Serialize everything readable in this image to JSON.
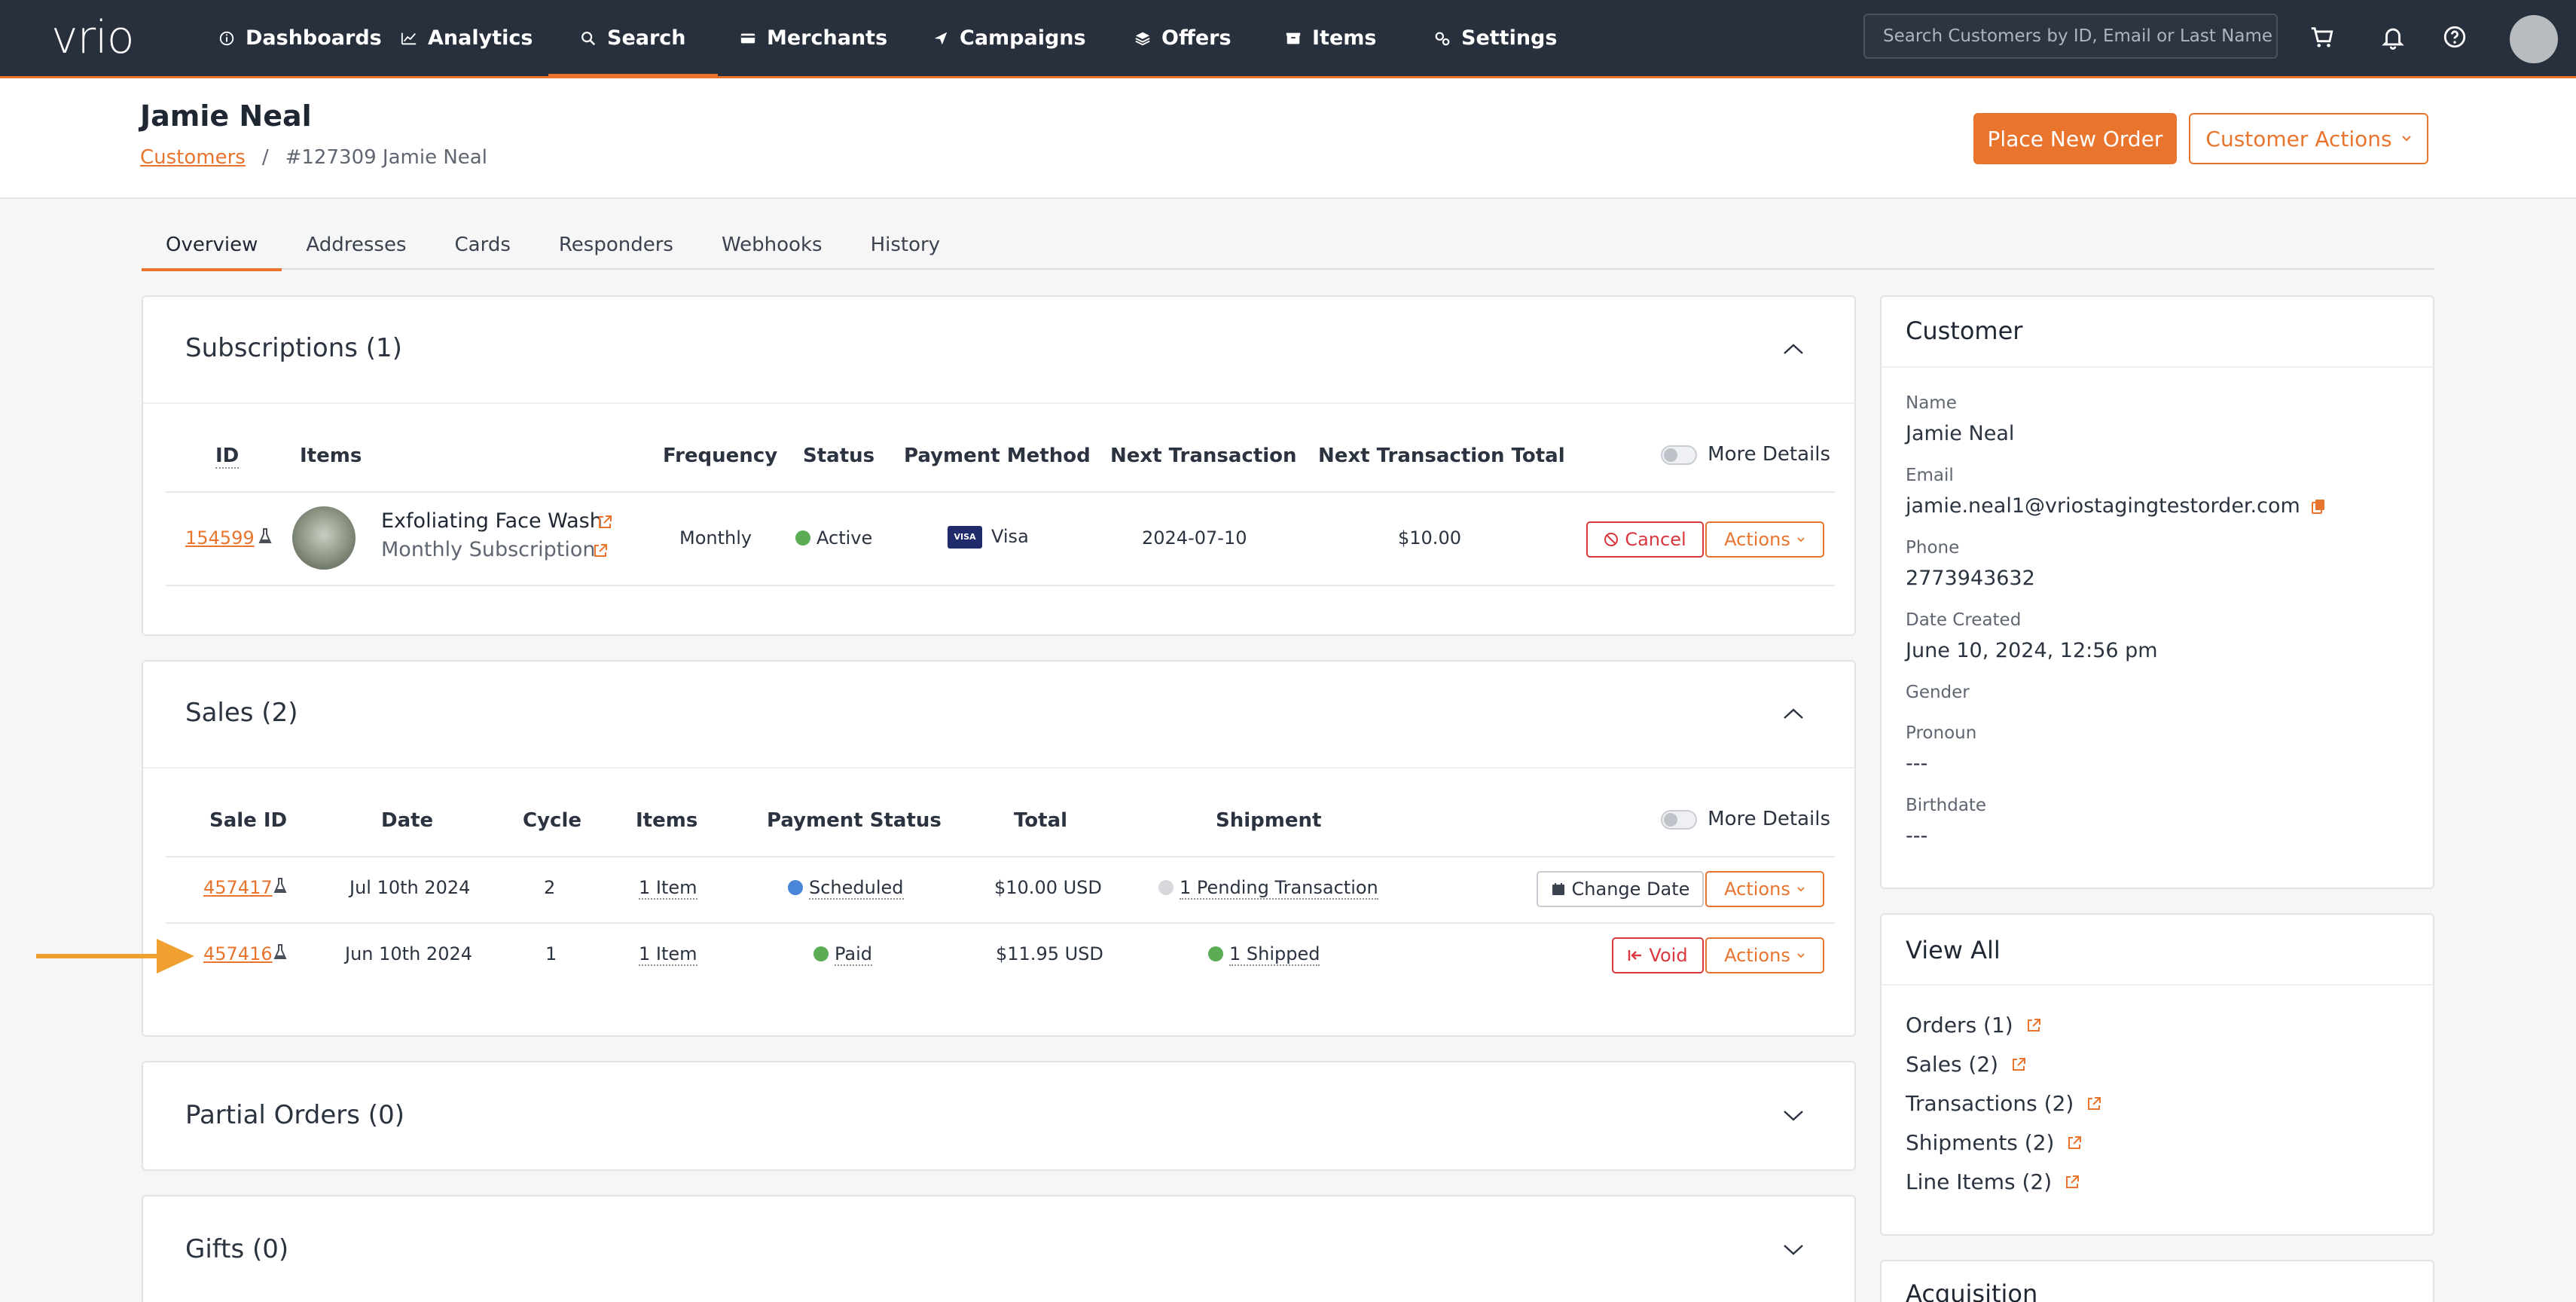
{
  "nav": {
    "logo": "vrio",
    "items": [
      {
        "label": "Dashboards",
        "icon": "info-circle-icon"
      },
      {
        "label": "Analytics",
        "icon": "line-chart-icon"
      },
      {
        "label": "Search",
        "icon": "search-icon"
      },
      {
        "label": "Merchants",
        "icon": "credit-card-icon"
      },
      {
        "label": "Campaigns",
        "icon": "paper-plane-icon"
      },
      {
        "label": "Offers",
        "icon": "layers-icon"
      },
      {
        "label": "Items",
        "icon": "box-icon"
      },
      {
        "label": "Settings",
        "icon": "gears-icon"
      }
    ],
    "active": "Search",
    "search_placeholder": "Search Customers by ID, Email or Last Name"
  },
  "header": {
    "title": "Jamie Neal",
    "breadcrumb_root": "Customers",
    "breadcrumb_sep": "/",
    "breadcrumb_current": "#127309 Jamie Neal",
    "place_order_label": "Place New Order",
    "customer_actions_label": "Customer Actions"
  },
  "tabs": [
    "Overview",
    "Addresses",
    "Cards",
    "Responders",
    "Webhooks",
    "History"
  ],
  "active_tab": "Overview",
  "subscriptions": {
    "title": "Subscriptions (1)",
    "more_details": "More Details",
    "columns": [
      "ID",
      "Items",
      "Frequency",
      "Status",
      "Payment Method",
      "Next Transaction",
      "Next Transaction Total"
    ],
    "rows": [
      {
        "id": "154599",
        "item_name": "Exfoliating Face Wash",
        "item_sub": "Monthly Subscription",
        "frequency": "Monthly",
        "status": "Active",
        "payment_method": "Visa",
        "card_badge": "VISA",
        "next_transaction": "2024-07-10",
        "next_total": "$10.00",
        "cancel_label": "Cancel",
        "actions_label": "Actions"
      }
    ]
  },
  "sales": {
    "title": "Sales (2)",
    "more_details": "More Details",
    "columns": [
      "Sale ID",
      "Date",
      "Cycle",
      "Items",
      "Payment Status",
      "Total",
      "Shipment"
    ],
    "rows": [
      {
        "id": "457417",
        "date": "Jul 10th 2024",
        "cycle": "2",
        "items": "1 Item",
        "payment_status": "Scheduled",
        "payment_color": "#4a86d8",
        "total": "$10.00 USD",
        "shipment": "1 Pending Transaction",
        "shipment_color": "#d6d8dc",
        "action1": "Change Date",
        "actions_label": "Actions"
      },
      {
        "id": "457416",
        "date": "Jun 10th 2024",
        "cycle": "1",
        "items": "1 Item",
        "payment_status": "Paid",
        "payment_color": "#5aac55",
        "total": "$11.95 USD",
        "shipment": "1 Shipped",
        "shipment_color": "#5aac55",
        "action1": "Void",
        "actions_label": "Actions"
      }
    ]
  },
  "partial_orders": {
    "title": "Partial Orders (0)"
  },
  "gifts": {
    "title": "Gifts (0)"
  },
  "customer": {
    "title": "Customer",
    "fields": [
      {
        "label": "Name",
        "value": "Jamie Neal"
      },
      {
        "label": "Email",
        "value": "jamie.neal1@vriostagingtestorder.com"
      },
      {
        "label": "Phone",
        "value": "2773943632"
      },
      {
        "label": "Date Created",
        "value": "June 10, 2024, 12:56 pm"
      },
      {
        "label": "Gender",
        "value": ""
      },
      {
        "label": "Pronoun",
        "value": "---"
      },
      {
        "label": "Birthdate",
        "value": "---"
      }
    ]
  },
  "view_all": {
    "title": "View All",
    "items": [
      "Orders (1)",
      "Sales (2)",
      "Transactions (2)",
      "Shipments (2)",
      "Line Items (2)"
    ]
  },
  "acquisition": {
    "title": "Acquisition"
  },
  "colors": {
    "accent": "#e8742d",
    "nav_bg": "#29303d",
    "active_green": "#5aac55",
    "danger": "#d9363e"
  }
}
